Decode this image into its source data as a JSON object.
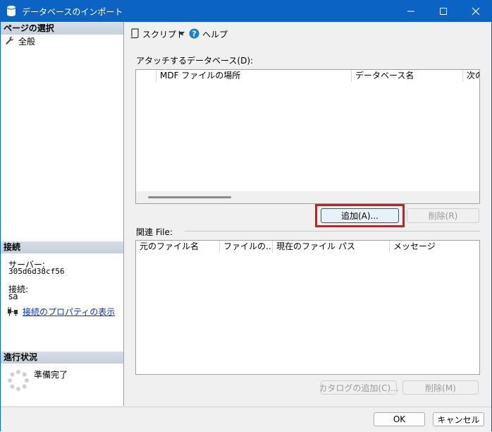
{
  "window": {
    "title": "データベースのインポート",
    "titlebar_color": "#0b63c4"
  },
  "left_pane": {
    "page_select_header": "ページの選択",
    "pages": [
      {
        "label": "全般",
        "icon": "wrench-icon"
      }
    ],
    "connection_header": "接続",
    "server_label": "サーバー:",
    "server_value": "305d6d38cf56",
    "connection_label": "接続:",
    "connection_value": "sa",
    "connection_properties_link": "接続のプロパティの表示",
    "progress_header": "進行状況",
    "progress_status": "準備完了"
  },
  "toolbar": {
    "script_label": "スクリプト",
    "help_label": "ヘルプ"
  },
  "attach_section": {
    "label": "アタッチするデータベース(D):",
    "columns": [
      "",
      "MDF ファイルの場所",
      "データベース名",
      "次の"
    ]
  },
  "attach_buttons": {
    "add": "追加(A)...",
    "remove": "削除(R)"
  },
  "related_files": {
    "label": "関連 File:",
    "columns": [
      "元のファイル名",
      "ファイルの...",
      "現在のファイル パス",
      "メッセージ"
    ]
  },
  "related_buttons": {
    "add_catalog": "カタログの追加(C)...",
    "remove": "削除(M)"
  },
  "footer": {
    "ok": "OK",
    "cancel": "キャンセル"
  },
  "highlight_color": "#e0151b"
}
